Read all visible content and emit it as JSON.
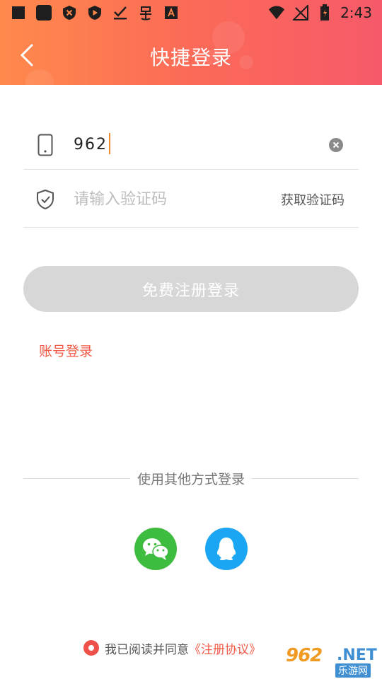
{
  "status_bar": {
    "time": "2:43",
    "left_icons": [
      "square-icon",
      "rounded-square-icon",
      "shield-x-icon",
      "play-shield-icon",
      "download-check-icon",
      "bug-icon",
      "letter-a-icon"
    ],
    "right_icons": [
      "wifi-icon",
      "no-signal-icon",
      "battery-icon"
    ]
  },
  "header": {
    "title": "快捷登录",
    "back_icon": "chevron-left-icon"
  },
  "form": {
    "phone_value": "962",
    "code_placeholder": "请输入验证码",
    "get_code_label": "获取验证码",
    "register_label": "免费注册登录",
    "account_login_label": "账号登录"
  },
  "other_login": {
    "label": "使用其他方式登录",
    "options": [
      "wechat-icon",
      "qq-icon"
    ]
  },
  "agreement": {
    "text": "我已阅读并同意",
    "link": "《注册协议》"
  },
  "watermark": {
    "brand": "962",
    "domain": ".NET",
    "sub": "乐游网"
  },
  "colors": {
    "accent": "#f05a47",
    "header_start": "#ff8a4c",
    "header_end": "#f65a6a",
    "wechat": "#3dbc3f",
    "qq": "#1aa6f2",
    "disabled_button": "#d7d7d7"
  }
}
